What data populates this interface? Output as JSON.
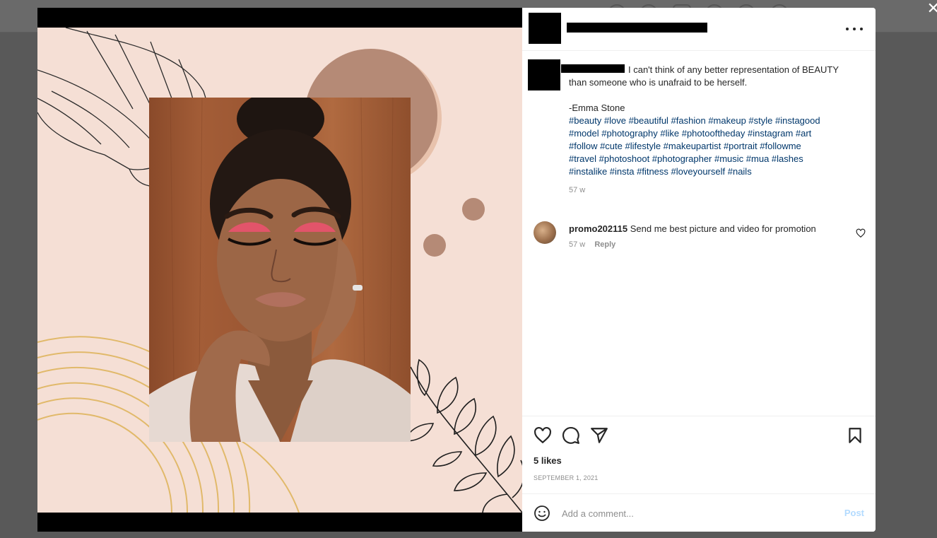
{
  "post": {
    "caption": "I can't think of any better representation of BEAUTY\nthan someone who is unafraid to be herself.\n\n-Emma Stone\n",
    "hashtags_line1": "#beauty #love #beautiful #fashion #makeup #style #instagood",
    "hashtags_line2": "#model #photography #like #photooftheday #instagram #art",
    "hashtags_line3": "#follow #cute #lifestyle #makeupartist #portrait #followme",
    "hashtags_line4": "#travel #photoshoot #photographer #music #mua #lashes",
    "hashtags_line5": "#instalike #insta #fitness #loveyourself #nails",
    "caption_time": "57 w"
  },
  "comments": [
    {
      "username": "promo202115",
      "text": "Send me best picture and video for promotion",
      "time": "57 w",
      "reply_label": "Reply"
    }
  ],
  "footer": {
    "likes": "5 likes",
    "date": "SEPTEMBER 1, 2021",
    "comment_placeholder": "Add a comment...",
    "post_label": "Post"
  },
  "ui": {
    "close_glyph": "✕"
  },
  "colors": {
    "artboard_bg": "#f5dfd5",
    "circle_brown": "#b58a76",
    "circle_shadow": "#e8c2ac",
    "arc_gold": "#e1b96a",
    "hashtag_blue": "#00376b",
    "post_disabled": "#b3dbff"
  },
  "icons": [
    "more-icon",
    "heart-icon",
    "comment-icon",
    "share-icon",
    "bookmark-icon",
    "emoji-icon",
    "close-icon"
  ]
}
